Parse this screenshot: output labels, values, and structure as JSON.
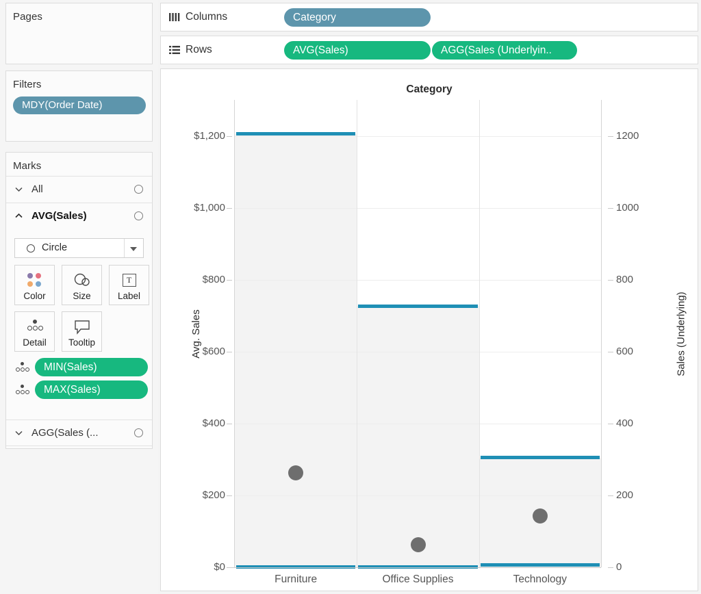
{
  "left_panel": {
    "pages": {
      "title": "Pages"
    },
    "filters": {
      "title": "Filters",
      "pills": [
        "MDY(Order Date)"
      ]
    },
    "marks": {
      "title": "Marks",
      "rows": [
        {
          "label": "All",
          "chevron": "chevron-down-icon"
        },
        {
          "label": "AVG(Sales)",
          "chevron": "chevron-up-icon"
        },
        {
          "label": "AGG(Sales (...",
          "chevron": "chevron-down-icon"
        }
      ],
      "mark_type": "Circle",
      "buttons": [
        {
          "label": "Color",
          "icon": "color-palette-icon"
        },
        {
          "label": "Size",
          "icon": "size-circles-icon"
        },
        {
          "label": "Label",
          "icon": "label-text-icon"
        },
        {
          "label": "Detail",
          "icon": "detail-dots-icon"
        },
        {
          "label": "Tooltip",
          "icon": "tooltip-bubble-icon"
        }
      ],
      "shelf_pills": [
        "MIN(Sales)",
        "MAX(Sales)"
      ]
    }
  },
  "shelves": {
    "columns": {
      "name": "Columns",
      "icon": "columns-icon",
      "pills": [
        "Category"
      ]
    },
    "rows": {
      "name": "Rows",
      "icon": "rows-icon",
      "pills": [
        "AVG(Sales)",
        "AGG(Sales (Underlyin.."
      ]
    }
  },
  "colors": {
    "pill_blue": "#5d95ac",
    "pill_green": "#17b87f",
    "gantt_blue": "#1f8fb5",
    "circle_gray": "#6e6e6e",
    "panel_bg": "#f3f3f3"
  },
  "chart_data": {
    "type": "bar",
    "title": "Category",
    "xlabel": "",
    "ylabel": "Avg. Sales",
    "y2label": "Sales (Underlying)",
    "categories": [
      "Furniture",
      "Office Supplies",
      "Technology"
    ],
    "ylim": [
      0,
      1300
    ],
    "y_ticks": [
      "$0",
      "$200",
      "$400",
      "$600",
      "$800",
      "$1,000",
      "$1,200"
    ],
    "y_tick_values": [
      0,
      200,
      400,
      600,
      800,
      1000,
      1200
    ],
    "y2lim": [
      0,
      1300
    ],
    "y2_ticks": [
      "0",
      "200",
      "400",
      "600",
      "800",
      "1000",
      "1200"
    ],
    "y2_tick_values": [
      0,
      200,
      400,
      600,
      800,
      1000,
      1200
    ],
    "grid": true,
    "legend": "none",
    "series": [
      {
        "name": "AVG(Sales)",
        "mark": "circle",
        "color": "#6e6e6e",
        "values": [
          262,
          63,
          143
        ]
      },
      {
        "name": "MAX(Sales)",
        "mark": "gantt-line",
        "color": "#1f8fb5",
        "values": [
          1205,
          727,
          305
        ]
      },
      {
        "name": "MIN(Sales)",
        "mark": "gantt-line",
        "color": "#1f8fb5",
        "values": [
          1,
          1,
          7
        ]
      }
    ]
  }
}
